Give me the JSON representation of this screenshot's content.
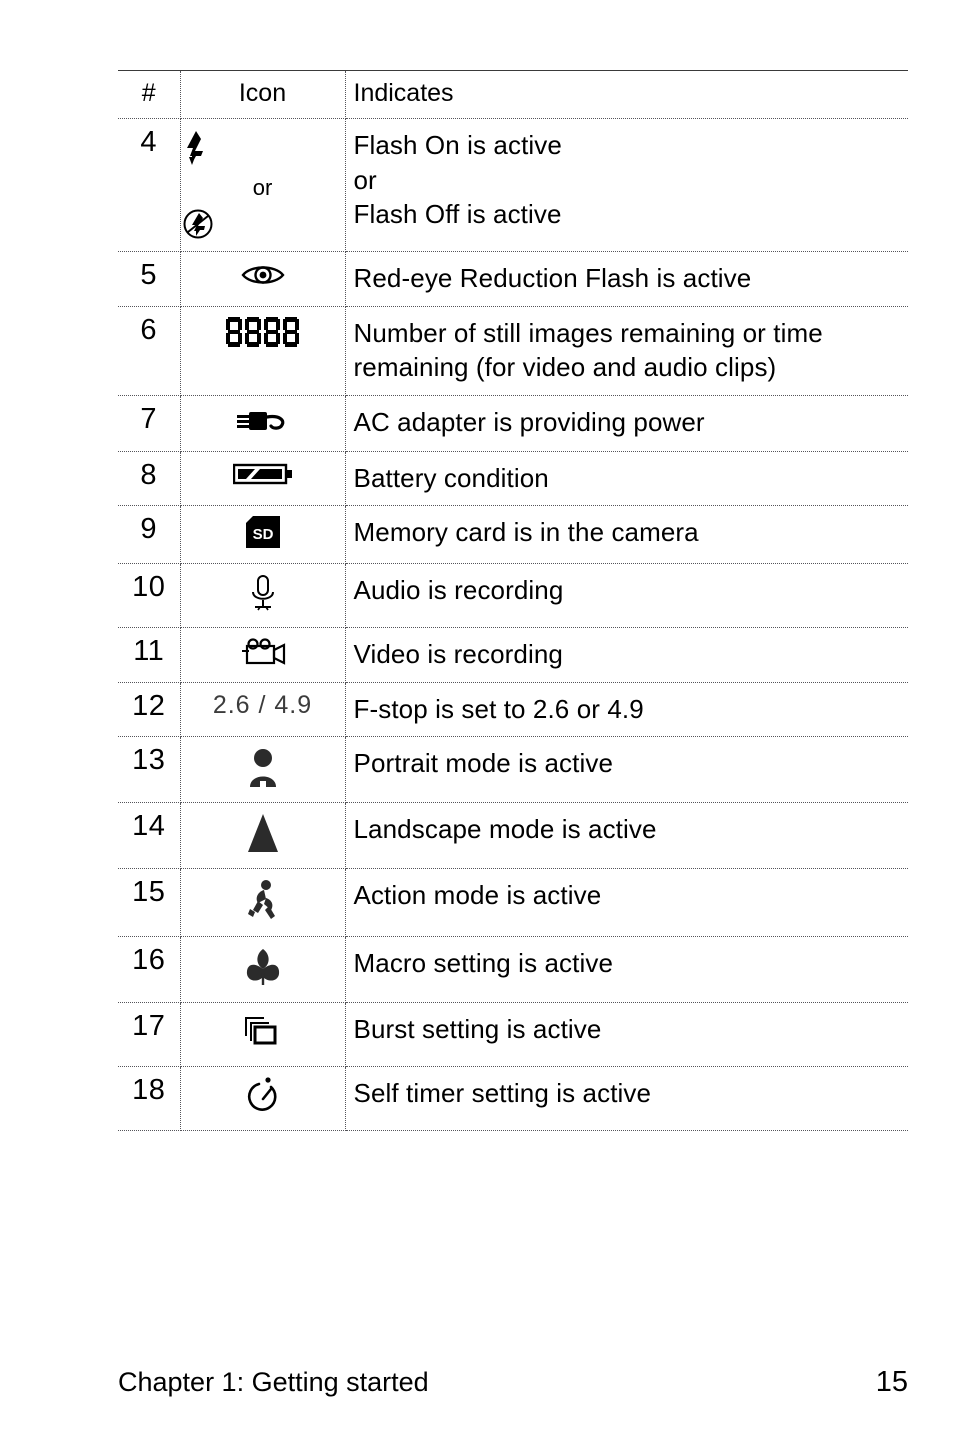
{
  "page": {
    "footer_left": "Chapter 1: Getting started",
    "footer_page_number": "15",
    "text_color": "#000000",
    "background_color": "#ffffff",
    "rule_color": "#55555a"
  },
  "table": {
    "headers": {
      "num": "#",
      "icon": "Icon",
      "indicates": "Indicates"
    },
    "rows": [
      {
        "num": "4",
        "icon_names": [
          "flash-on-icon",
          "flash-off-icon"
        ],
        "icon_separator": "or",
        "desc": "Flash On is active\nor\nFlash Off is active"
      },
      {
        "num": "5",
        "icon_names": [
          "red-eye-reduction-icon"
        ],
        "desc": "Red-eye Reduction Flash is active"
      },
      {
        "num": "6",
        "icon_names": [
          "seven-segment-counter-icon"
        ],
        "icon_text": "8888",
        "desc": "Number of still images remaining or time remaining (for video and audio clips)"
      },
      {
        "num": "7",
        "icon_names": [
          "ac-adapter-plug-icon"
        ],
        "desc": "AC adapter is providing power"
      },
      {
        "num": "8",
        "icon_names": [
          "battery-icon"
        ],
        "desc": "Battery condition"
      },
      {
        "num": "9",
        "icon_names": [
          "sd-card-icon"
        ],
        "icon_text": "SD",
        "desc": "Memory card is in the camera"
      },
      {
        "num": "10",
        "icon_names": [
          "microphone-icon"
        ],
        "desc": "Audio is recording"
      },
      {
        "num": "11",
        "icon_names": [
          "video-camera-icon"
        ],
        "desc": "Video is recording"
      },
      {
        "num": "12",
        "icon_names": [
          "f-stop-value-text"
        ],
        "icon_text": "2.6 / 4.9",
        "desc": "F-stop is set to 2.6 or 4.9"
      },
      {
        "num": "13",
        "icon_names": [
          "portrait-mode-icon"
        ],
        "desc": "Portrait mode is active"
      },
      {
        "num": "14",
        "icon_names": [
          "landscape-mode-icon"
        ],
        "desc": "Landscape mode is active"
      },
      {
        "num": "15",
        "icon_names": [
          "action-mode-icon"
        ],
        "desc": "Action mode is active"
      },
      {
        "num": "16",
        "icon_names": [
          "macro-flower-icon"
        ],
        "desc": "Macro setting is active"
      },
      {
        "num": "17",
        "icon_names": [
          "burst-stack-icon"
        ],
        "desc": "Burst setting is active"
      },
      {
        "num": "18",
        "icon_names": [
          "self-timer-icon"
        ],
        "desc": "Self timer setting is active"
      }
    ]
  }
}
